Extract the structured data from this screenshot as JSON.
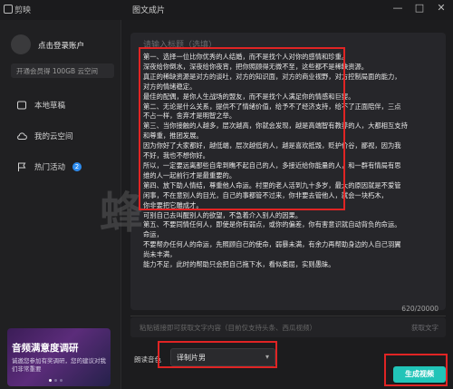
{
  "app": {
    "name": "剪映",
    "panel_title": "图文成片",
    "window_controls": [
      "—",
      "□",
      "✕"
    ]
  },
  "sidebar": {
    "login_label": "点击登录账户",
    "storage_text": "开通会员得 100GB 云空间",
    "items": [
      {
        "label": "本地草稿",
        "icon": "draft-icon"
      },
      {
        "label": "我的云空间",
        "icon": "cloud-icon"
      },
      {
        "label": "热门活动",
        "icon": "flag-icon",
        "badge": "2"
      }
    ],
    "promo": {
      "title": "音频满意度调研",
      "subtitle": "诚邀您参加有奖调研，您的建议对我们非常重要"
    }
  },
  "editor": {
    "placeholder": "请输入标题（选填）",
    "lines": [
      "第一、选择一位比你优秀的人结婚，而不是找个人对你的感情和珍重。",
      "深夜给你倒水，深夜给你夜宵，把你照顾得无微不至，这些都不是稀缺资源。",
      "真正的稀缺资源是对方的谈吐，对方的知识面，对方的商业视野，对方控制局面的能力，",
      "对方的情绪稳定。",
      "最佳的配偶，是你人生战场的盟友，而不是找个人满足你的情感和巨婴。",
      "第二、无论是什么关系，提供不了情绪价值，给予不了经济支持，给不了正面陪伴，三点",
      "不占一样，舍弃才是明智之举。",
      "第三、当你接触的人越多，层次越高，你就会发现，越是高端智有教养的人，大都相互支持",
      "和尊重，推团发展。",
      "因为你好了大家都好，越低端，层次越低的人，越是喜欢抵毁，贬护价谷，鄙视，因为我",
      "不好，我也不想你好。",
      "所以，一定要远离那些自卑到瞧不起自己的人，多接近给你能量的人，和一群有情局有思",
      "维的人一起前行才是最重要的。",
      "第四、放下助人情结，尊重他人命运。村里的老人活到九十多岁，最大的原因就是不爱管",
      "闲事，不在意别人的目光，自己的事都管不过来，你非要去管他人，就会一块朽木，",
      "你非要把它雕成才。",
      "可别自己去叫醒别人的欲望，不急着介入别人的因果。",
      "第五、不要同情任何人，即使是你有弱点，或你的偏差，你有害意识就自动背负的命运。",
      "命运，",
      "不要帮办任何人的命运，先照顾自己的使命，弱暴未满，有余力再帮助身边的人自己羽翼",
      "尚未丰满，",
      "能力不足，此时的帮助只会把自己拖下水，看似委屈，实则愚昧。"
    ],
    "char_count": "620/20000"
  },
  "link_input": {
    "placeholder": "粘贴链接即可获取文字内容（目前仅支持头条、西瓜视频）",
    "action": "获取文字"
  },
  "voice": {
    "label": "朗读音色",
    "selected": "译制片男"
  },
  "generate_button": "生成视频",
  "watermark": "蜂",
  "colors": {
    "background": "#1c1c1e",
    "accent": "#21c4b8",
    "annotation": "#e02424",
    "badge": "#2d8cf0"
  }
}
